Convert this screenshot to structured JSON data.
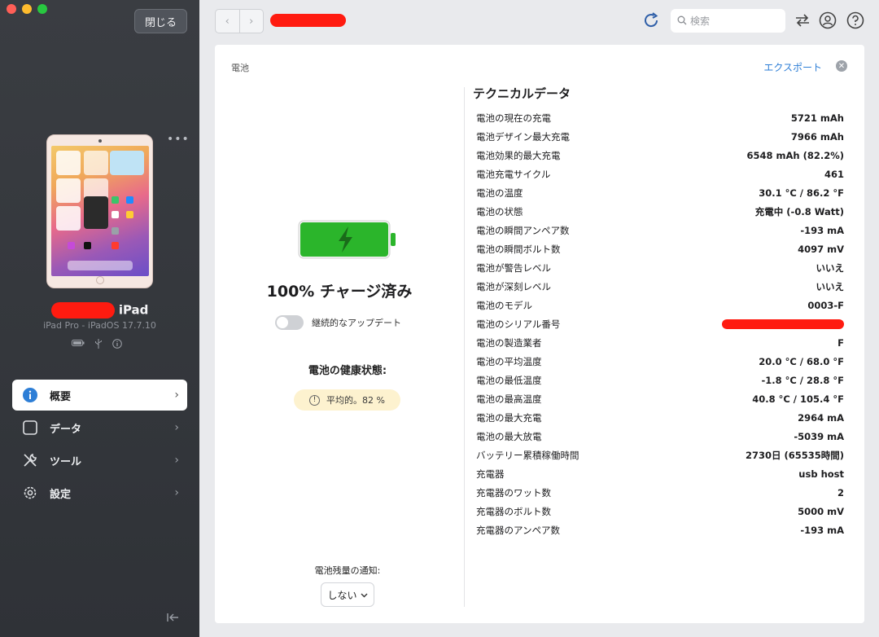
{
  "sidebar": {
    "close_label": "閉じる",
    "device": {
      "name_suffix": "iPad",
      "subtitle": "iPad Pro - iPadOS 17.7.10",
      "more": "•••"
    },
    "nav": [
      {
        "label": "概要",
        "icon": "info-icon",
        "active": true
      },
      {
        "label": "データ",
        "icon": "square-icon",
        "active": false
      },
      {
        "label": "ツール",
        "icon": "tools-icon",
        "active": false
      },
      {
        "label": "設定",
        "icon": "gear-icon",
        "active": false
      }
    ]
  },
  "topbar": {
    "search_placeholder": "検索"
  },
  "main": {
    "breadcrumb": "電池",
    "export_label": "エクスポート",
    "charge_status": "100% チャージ済み",
    "continuous_update_label": "継続的なアップデート",
    "health_title": "電池の健康状態:",
    "health_value": "平均的。82 %",
    "notify_label": "電池残量の通知:",
    "notify_value": "しない",
    "battery_level": 1.0,
    "colors": {
      "battery": "#2bb52b",
      "accent": "#2d7ed6",
      "badge": "#fdf2cf"
    }
  },
  "tech": {
    "title": "テクニカルデータ",
    "rows": [
      {
        "k": "電池の現在の充電",
        "v": "5721 mAh"
      },
      {
        "k": "電池デザイン最大充電",
        "v": "7966 mAh"
      },
      {
        "k": "電池効果的最大充電",
        "v": "6548 mAh (82.2%)"
      },
      {
        "k": "電池充電サイクル",
        "v": "461"
      },
      {
        "k": "電池の温度",
        "v": "30.1 °C / 86.2 °F"
      },
      {
        "k": "電池の状態",
        "v": "充電中 (-0.8 Watt)"
      },
      {
        "k": "電池の瞬間アンペア数",
        "v": "-193 mA"
      },
      {
        "k": "電池の瞬間ボルト数",
        "v": "4097 mV"
      },
      {
        "k": "電池が警告レベル",
        "v": "いいえ"
      },
      {
        "k": "電池が深刻レベル",
        "v": "いいえ"
      },
      {
        "k": "電池のモデル",
        "v": "0003-F"
      },
      {
        "k": "電池のシリアル番号",
        "v": ""
      },
      {
        "k": "電池の製造業者",
        "v": "F"
      },
      {
        "k": "電池の平均温度",
        "v": "20.0 °C / 68.0 °F"
      },
      {
        "k": "電池の最低温度",
        "v": "-1.8 °C / 28.8 °F"
      },
      {
        "k": "電池の最高温度",
        "v": "40.8 °C / 105.4 °F"
      },
      {
        "k": "電池の最大充電",
        "v": "2964 mA"
      },
      {
        "k": "電池の最大放電",
        "v": "-5039 mA"
      },
      {
        "k": "バッテリー累積稼働時間",
        "v": "2730日 (65535時間)"
      },
      {
        "k": "充電器",
        "v": "usb host"
      },
      {
        "k": "充電器のワット数",
        "v": "2"
      },
      {
        "k": "充電器のボルト数",
        "v": "5000 mV"
      },
      {
        "k": "充電器のアンペア数",
        "v": "-193 mA"
      }
    ]
  }
}
